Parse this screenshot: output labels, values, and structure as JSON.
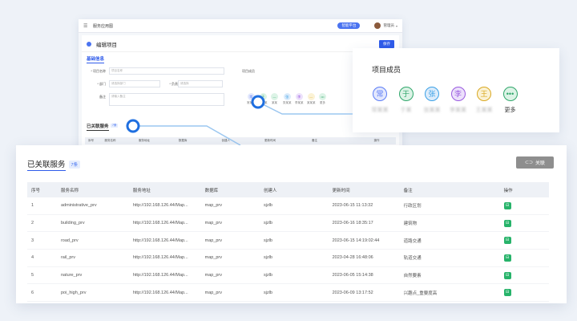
{
  "app": {
    "title": "服务应用图",
    "system_button": "智能平台",
    "user_name": "管理员"
  },
  "editor": {
    "title": "编辑项目",
    "save_label": "保存",
    "basic_info": "基础信息",
    "fields": {
      "project_name_label": "* 项目名称",
      "project_name_placeholder": "项目名称",
      "dept_label": "* 部门",
      "dept_placeholder": "请选择部门",
      "owner_label": "* 负责人",
      "owner_placeholder": "请选择",
      "desc_label": "备注",
      "desc_placeholder": "请输入备注"
    },
    "members_label": "项目成员",
    "bg_members": [
      {
        "glyph": "常",
        "name": "常某某",
        "color": "#5b7cf6",
        "bg": "#e3e8fd"
      },
      {
        "glyph": "于",
        "name": "于某某",
        "color": "#2fa66a",
        "bg": "#dcf3e6"
      },
      {
        "glyph": "—",
        "name": "某某",
        "color": "#2fa66a",
        "bg": "#dcf3e6"
      },
      {
        "glyph": "张",
        "name": "张某某",
        "color": "#3aa0e6",
        "bg": "#dcecfb"
      },
      {
        "glyph": "李",
        "name": "李某某",
        "color": "#9a5ae0",
        "bg": "#ece1fb"
      },
      {
        "glyph": "—",
        "name": "某某某",
        "color": "#d9a820",
        "bg": "#fbf2d5"
      },
      {
        "glyph": "•••",
        "name": "更多",
        "color": "#2fa66a",
        "bg": "#dcf3e6"
      }
    ],
    "linked_label": "已关联服务",
    "linked_count": "7条",
    "bg_table_headers": [
      "序号",
      "服务名称",
      "服务地址",
      "数据库",
      "创建人",
      "更新时间",
      "备注",
      "操作"
    ]
  },
  "members_popup": {
    "title": "项目成员",
    "members": [
      {
        "glyph": "常",
        "name": "常某某",
        "color": "#5b7cf6",
        "bg": "#e3e8fd",
        "blurred": true
      },
      {
        "glyph": "于",
        "name": "于某",
        "color": "#2fa66a",
        "bg": "#dcf3e6",
        "blurred": true
      },
      {
        "glyph": "张",
        "name": "张某某",
        "color": "#3aa0e6",
        "bg": "#dcecfb",
        "blurred": true
      },
      {
        "glyph": "李",
        "name": "李某某",
        "color": "#9a5ae0",
        "bg": "#ece1fb",
        "blurred": true
      },
      {
        "glyph": "王",
        "name": "王某某",
        "color": "#d9a820",
        "bg": "#fbf2d5",
        "blurred": true
      },
      {
        "glyph": "•••",
        "name": "更多",
        "color": "#2fa66a",
        "bg": "#dcf3e6",
        "blurred": false
      }
    ]
  },
  "services": {
    "title": "已关联服务",
    "count_badge": "7条",
    "link_button": "关联",
    "columns": [
      "序号",
      "服务名称",
      "服务地址",
      "数据库",
      "创建人",
      "更新时间",
      "备注",
      "操作"
    ],
    "rows": [
      [
        "1",
        "administrative_prv",
        "http://192.168.126.44/Map...",
        "map_prv",
        "sjzlb",
        "2023-06-15 11:13:32",
        "行政区划"
      ],
      [
        "2",
        "building_prv",
        "http://192.168.126.44/Map...",
        "map_prv",
        "sjzlb",
        "2023-06-16 18:35:17",
        "建筑物"
      ],
      [
        "3",
        "road_prv",
        "http://192.168.126.44/Map...",
        "map_prv",
        "sjzlb",
        "2023-06-15 14:19:02:44",
        "道路交通"
      ],
      [
        "4",
        "rail_prv",
        "http://192.168.126.44/Map...",
        "map_prv",
        "sjzlb",
        "2023-04-28 16:48:06",
        "轨道交通"
      ],
      [
        "5",
        "nature_prv",
        "http://192.168.126.44/Map...",
        "map_prv",
        "sjzlb",
        "2023-06-05 15:14:38",
        "自然要素"
      ],
      [
        "6",
        "poi_high_prv",
        "http://192.168.126.44/Map...",
        "map_prv",
        "sjzlb",
        "2023-06-09 13:17:52",
        "兴趣点_重要度高"
      ]
    ]
  },
  "colors": {
    "accent": "#2f5bea",
    "connector": "#9cc7f0",
    "hotspot": "#1f6fe0",
    "action_green": "#27b36a"
  }
}
